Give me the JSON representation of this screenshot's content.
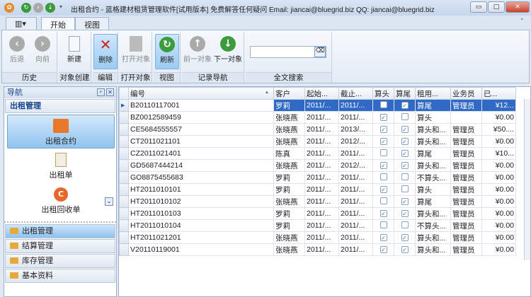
{
  "title": "出租合约 - 蓝格建材租赁管理软件[试用版本] 免费解答任何疑问 Email: jiancai@bluegrid.biz QQ: jiancai@bluegrid.biz",
  "tabs": [
    "开始",
    "视图"
  ],
  "ribbon": {
    "groups": [
      "历史",
      "对象创建",
      "编辑",
      "打开对象",
      "视图",
      "记录导航",
      "全文搜索"
    ],
    "back": "后退",
    "forward": "向前",
    "new": "新建",
    "delete": "删除",
    "open": "打开对象",
    "refresh": "刷新",
    "prev": "前一对象",
    "next": "下一对象",
    "search_value": ""
  },
  "nav": {
    "title": "导航",
    "section": "出租管理",
    "items": [
      "出租合约",
      "出租单",
      "出租回收单"
    ],
    "groups": [
      "出租管理",
      "结算管理",
      "库存管理",
      "基本资料"
    ]
  },
  "grid": {
    "columns": [
      "编号",
      "客户",
      "起始...",
      "截止...",
      "算头",
      "算尾",
      "租用...",
      "业务员",
      "已..."
    ],
    "rows": [
      [
        "B20110117001",
        "罗莉",
        "2011/...",
        "2011/...",
        false,
        true,
        "算尾",
        "管理员",
        "¥12..."
      ],
      [
        "BZ0012589459",
        "张晓燕",
        "2011/...",
        "2011/...",
        true,
        false,
        "算头",
        "",
        "¥0.00"
      ],
      [
        "CE5684555557",
        "张晓燕",
        "2011/...",
        "2013/...",
        true,
        true,
        "算头和...",
        "管理员",
        "¥50...."
      ],
      [
        "CT2011021101",
        "张晓燕",
        "2011/...",
        "2012/...",
        true,
        true,
        "算头和...",
        "管理员",
        "¥0.00"
      ],
      [
        "CZ2011021401",
        "陈真",
        "2011/...",
        "2011/...",
        false,
        true,
        "算尾",
        "管理员",
        "¥10..."
      ],
      [
        "GD5687444214",
        "张晓燕",
        "2011/...",
        "2012/...",
        true,
        true,
        "算头和...",
        "管理员",
        "¥0.00"
      ],
      [
        "GO8875455683",
        "罗莉",
        "2011/...",
        "2011/...",
        false,
        false,
        "不算头...",
        "管理员",
        "¥0.00"
      ],
      [
        "HT2011010101",
        "罗莉",
        "2011/...",
        "2011/...",
        true,
        false,
        "算头",
        "管理员",
        "¥0.00"
      ],
      [
        "HT2011010102",
        "张晓燕",
        "2011/...",
        "2011/...",
        false,
        true,
        "算尾",
        "管理员",
        "¥0.00"
      ],
      [
        "HT2011010103",
        "罗莉",
        "2011/...",
        "2011/...",
        true,
        true,
        "算头和...",
        "管理员",
        "¥0.00"
      ],
      [
        "HT2011010104",
        "罗莉",
        "2011/...",
        "2011/...",
        false,
        false,
        "不算头...",
        "管理员",
        "¥0.00"
      ],
      [
        "HT2011021201",
        "张晓燕",
        "2011/...",
        "2011/...",
        true,
        true,
        "算头和...",
        "管理员",
        "¥0.00"
      ],
      [
        "V20110119001",
        "张晓燕",
        "2011/...",
        "2011/...",
        true,
        true,
        "算头和...",
        "管理员",
        "¥0.00"
      ]
    ]
  }
}
